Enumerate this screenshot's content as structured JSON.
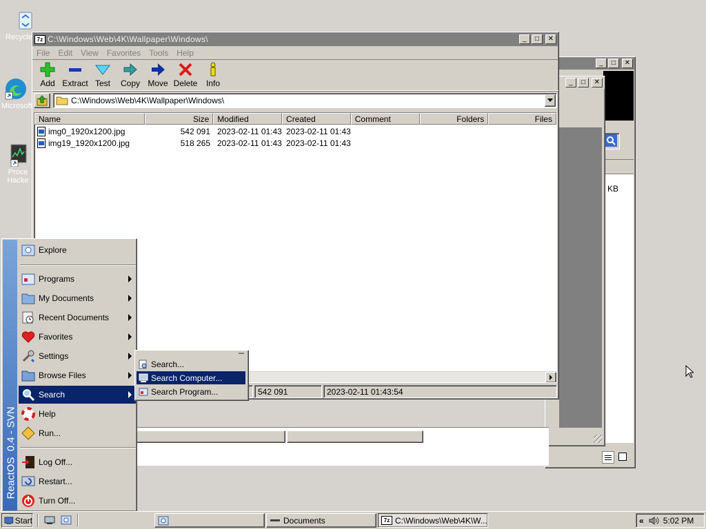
{
  "desktop": {
    "icons": [
      {
        "label": "Recycle"
      },
      {
        "label": "Microsoft"
      },
      {
        "label": "Proce Hacke"
      }
    ]
  },
  "bg_window1": {
    "kb_label": "KB"
  },
  "main_window": {
    "title": "C:\\Windows\\Web\\4K\\Wallpaper\\Windows\\",
    "menu": [
      "File",
      "Edit",
      "View",
      "Favorites",
      "Tools",
      "Help"
    ],
    "toolbar": [
      {
        "label": "Add",
        "icon": "plus-icon"
      },
      {
        "label": "Extract",
        "icon": "minus-icon"
      },
      {
        "label": "Test",
        "icon": "check-icon"
      },
      {
        "label": "Copy",
        "icon": "copy-arrow-icon"
      },
      {
        "label": "Move",
        "icon": "move-arrow-icon"
      },
      {
        "label": "Delete",
        "icon": "delete-x-icon"
      },
      {
        "label": "Info",
        "icon": "info-icon"
      }
    ],
    "address": "C:\\Windows\\Web\\4K\\Wallpaper\\Windows\\",
    "columns": [
      "Name",
      "Size",
      "Modified",
      "Created",
      "Comment",
      "Folders",
      "Files"
    ],
    "files": [
      {
        "name": "img0_1920x1200.jpg",
        "size": "542 091",
        "modified": "2023-02-11 01:43",
        "created": "2023-02-11 01:43"
      },
      {
        "name": "img19_1920x1200.jpg",
        "size": "518 265",
        "modified": "2023-02-11 01:43",
        "created": "2023-02-11 01:43"
      }
    ],
    "status": {
      "size": "542 091",
      "date": "2023-02-11 01:43:54"
    }
  },
  "start_menu": {
    "banner": "ReactOS  0.4 - SVN",
    "items": [
      {
        "label": "Explore"
      },
      {
        "label": "Programs"
      },
      {
        "label": "My Documents"
      },
      {
        "label": "Recent Documents"
      },
      {
        "label": "Favorites"
      },
      {
        "label": "Settings"
      },
      {
        "label": "Browse Files"
      },
      {
        "label": "Search"
      },
      {
        "label": "Help"
      },
      {
        "label": "Run..."
      },
      {
        "label": "Log Off..."
      },
      {
        "label": "Restart..."
      },
      {
        "label": "Turn Off..."
      }
    ],
    "search_submenu": [
      {
        "label": "Search..."
      },
      {
        "label": "Search Computer..."
      },
      {
        "label": "Search Program..."
      }
    ]
  },
  "taskbar": {
    "start_label": "Start",
    "tasks": [
      {
        "label": ""
      },
      {
        "label": "Documents"
      },
      {
        "label": "C:\\Windows\\Web\\4K\\W..."
      }
    ],
    "clock": "5:02 PM"
  },
  "colors": {
    "selection": "#0a246a",
    "desktop": "#d6d3ce",
    "banner": "#4a78b8"
  }
}
